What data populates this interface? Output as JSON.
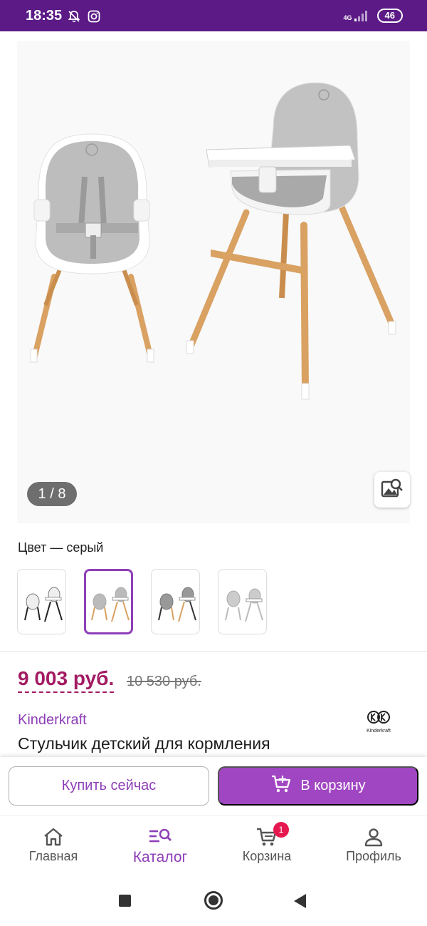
{
  "status_bar": {
    "time": "18:35",
    "network": "4G",
    "battery": "46",
    "background": "#5b1a86"
  },
  "gallery": {
    "counter": "1 / 8",
    "icons": [
      "image-search-icon"
    ]
  },
  "color": {
    "label": "Цвет — серый",
    "swatches": [
      {
        "name": "black",
        "selected": false
      },
      {
        "name": "gray",
        "selected": true
      },
      {
        "name": "gray-dark-legs",
        "selected": false
      },
      {
        "name": "white",
        "selected": false
      }
    ]
  },
  "price": {
    "current": "9 003 руб.",
    "old": "10 530 руб.",
    "accent": "#a31b62"
  },
  "brand": {
    "name": "Kinderkraft",
    "logo_text": "Kinderkraft",
    "color": "#8e3fb8"
  },
  "product": {
    "title": "Стульчик детский для кормления"
  },
  "actions": {
    "buy_now": "Купить сейчас",
    "add_to_cart": "В корзину",
    "cart_button_color": "#a146c2"
  },
  "bottom_nav": {
    "items": [
      {
        "label": "Главная",
        "icon": "home-icon",
        "active": false
      },
      {
        "label": "Каталог",
        "icon": "catalog-search-icon",
        "active": true
      },
      {
        "label": "Корзина",
        "icon": "cart-icon",
        "active": false,
        "badge": "1"
      },
      {
        "label": "Профиль",
        "icon": "profile-icon",
        "active": false
      }
    ]
  }
}
